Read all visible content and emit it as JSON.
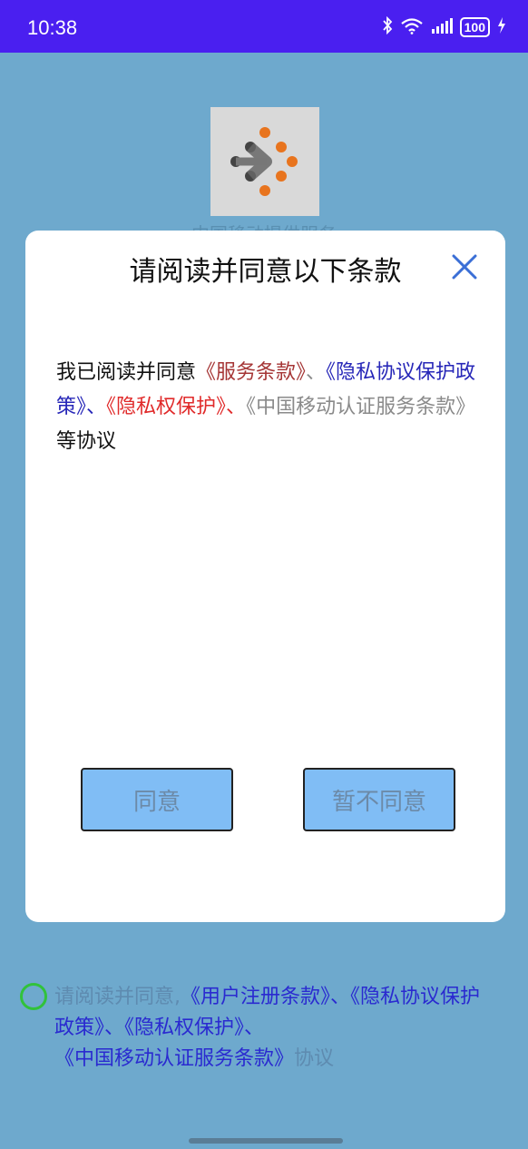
{
  "status_bar": {
    "time": "10:38",
    "battery": "100"
  },
  "provider": {
    "text": "中国移动提供服务"
  },
  "dialog": {
    "title": "请阅读并同意以下条款",
    "terms": {
      "prefix": "我已阅读并同意",
      "link1": "《服务条款》",
      "sep1": "、",
      "link2": "《隐私协议保护政策》",
      "sep2": "、",
      "link3": "《隐私权保护》",
      "sep3": "、",
      "link4": "《中国移动认证服务条款》",
      "suffix": "等协议"
    },
    "agree_label": "同意",
    "disagree_label": "暂不同意"
  },
  "consent": {
    "prefix": "请阅读并同意,",
    "link1": "《用户注册条款》",
    "sep1": "、",
    "link2": "《隐私协议保护政策》",
    "sep2": "、",
    "link3": "《隐私权保护》",
    "sep3": "、",
    "link4": "《中国移动认证服务条款》",
    "suffix": "协议"
  },
  "colors": {
    "status_bar": "#4a1ff0",
    "background": "#6ea9cd",
    "button": "#80bdf5",
    "radio": "#31c23b",
    "logo_orange": "#e8741e",
    "close_icon": "#3b6fd6"
  }
}
